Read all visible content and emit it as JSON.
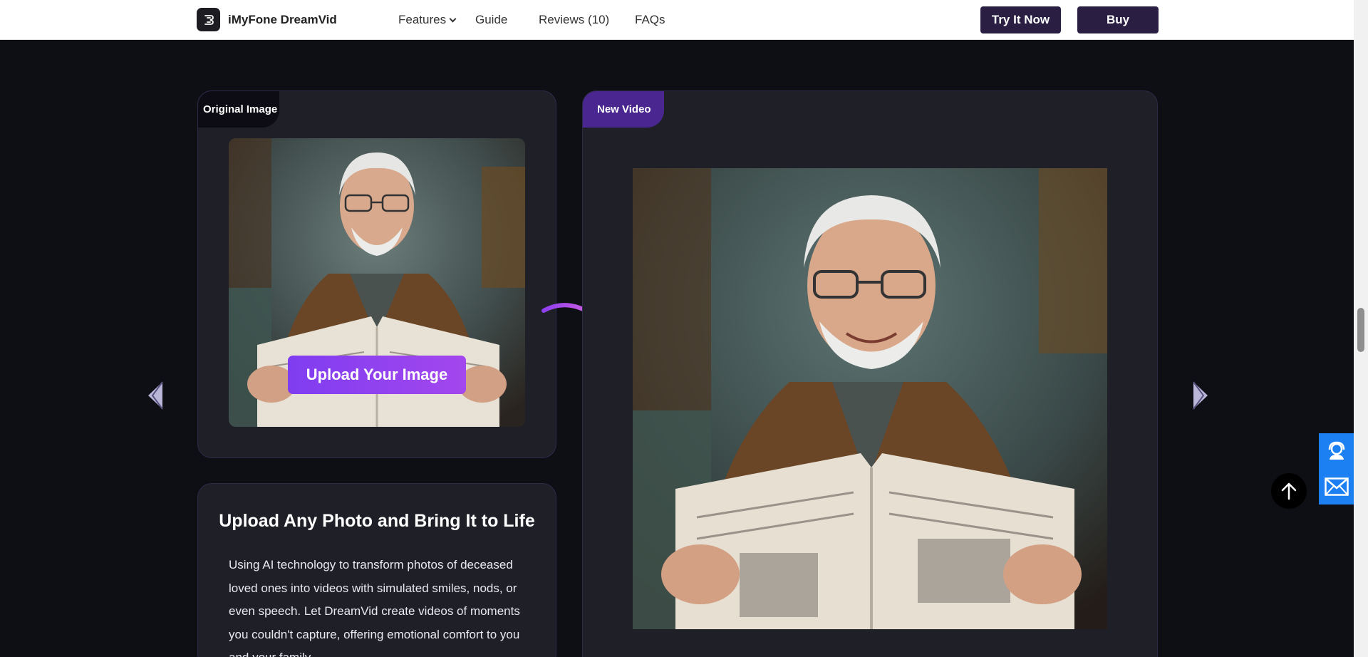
{
  "header": {
    "brand": "iMyFone DreamVid",
    "nav": [
      "Features",
      "Guide",
      "Reviews (10)",
      "FAQs"
    ],
    "try_label": "Try It Now",
    "buy_label": "Buy"
  },
  "original": {
    "tag": "Original Image",
    "upload_label": "Upload Your Image"
  },
  "result": {
    "tag": "New Video"
  },
  "feature": {
    "title": "Upload Any Photo and Bring It to Life",
    "body": "Using AI technology to transform photos of deceased loved ones into videos with simulated smiles, nods, or even speech. Let DreamVid create videos of moments you couldn't capture, offering emotional comfort to you and your family."
  },
  "colors": {
    "accent": "#8b3ff0",
    "nav_button": "#2a1f43",
    "contact_blue": "#1c7ff2"
  },
  "icons": [
    "logo-icon",
    "chevron-down-icon",
    "curved-arrow-icon",
    "arrow-left-icon",
    "arrow-right-icon",
    "support-agent-icon",
    "mail-icon",
    "arrow-up-icon"
  ]
}
